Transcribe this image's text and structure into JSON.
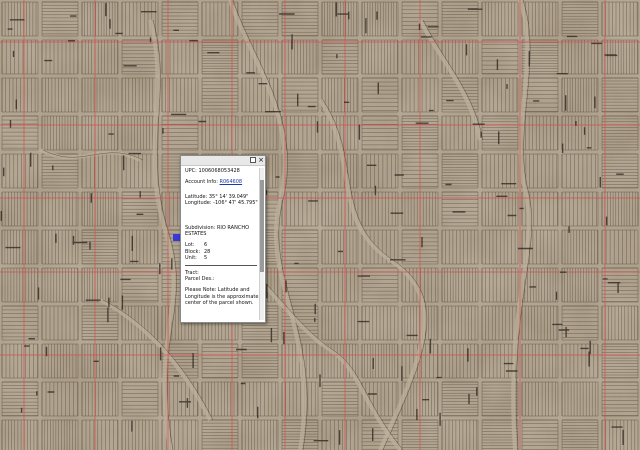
{
  "map": {
    "base_color": "#a59680",
    "parcel_line_color": "#3b3226",
    "boundary_color": "#d8464b",
    "road_color": "#bfb39c"
  },
  "popup": {
    "controls": {
      "maximize_icon": "square-icon",
      "close_icon": "close-icon"
    },
    "upc_label": "UPC:",
    "upc_value": "1006068053428",
    "account_label": "Account Info:",
    "account_link": "R064608",
    "latitude_label": "Latitude:",
    "latitude_value": "35° 14' 39.049\"",
    "longitude_label": "Longitude:",
    "longitude_value": "-106° 47' 45.795\"",
    "subdivision_label": "Subdivision:",
    "subdivision_value": "RIO RANCHO ESTATES",
    "lot_label": "Lot:",
    "lot_value": "6",
    "block_label": "Block:",
    "block_value": "28",
    "unit_label": "Unit:",
    "unit_value": "5",
    "tract_label": "Tract:",
    "parcel_des_label": "Parcel Des.:",
    "note": "Please Note: Latitude and Longitude is the approximate center of the parcel shown."
  }
}
